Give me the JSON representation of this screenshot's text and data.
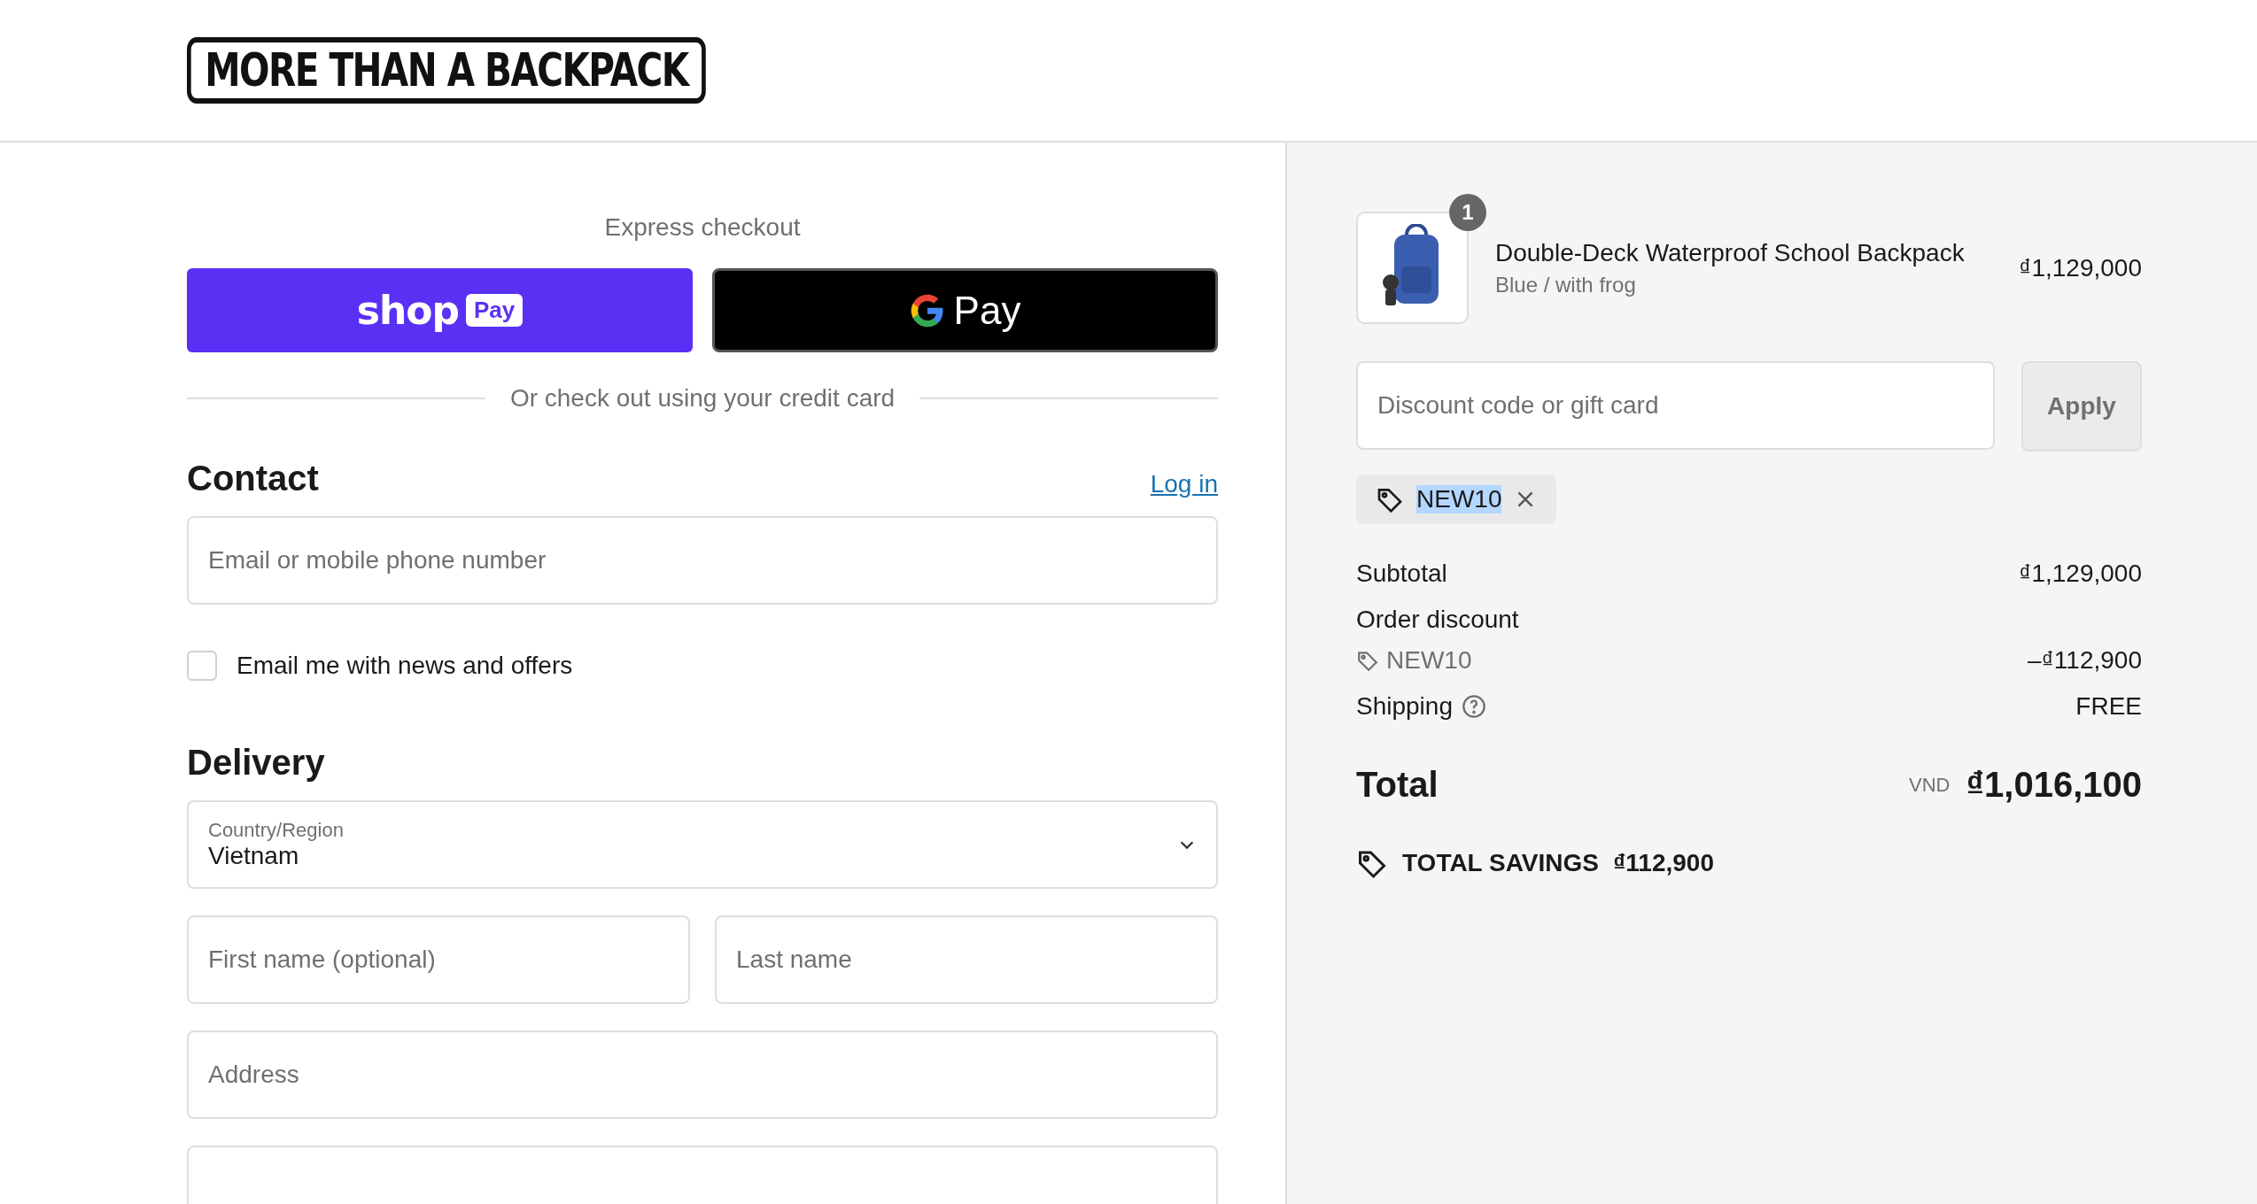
{
  "header": {
    "logo": "MORE THAN A BACKPACK"
  },
  "express_checkout": {
    "title": "Express checkout",
    "shop_pay": {
      "wordmark": "shop",
      "badge": "Pay"
    },
    "google_pay": {
      "label": "Pay"
    },
    "divider": "Or check out using your credit card"
  },
  "contact": {
    "title": "Contact",
    "login_link": "Log in",
    "email": {
      "placeholder": "Email or mobile phone number"
    },
    "newsletter": {
      "label": "Email me with news and offers",
      "checked": false
    }
  },
  "delivery": {
    "title": "Delivery",
    "fields": [
      {
        "kind": "select",
        "label": "Country/Region",
        "value": "Vietnam"
      },
      {
        "kind": "pair",
        "items": [
          {
            "placeholder": "First name (optional)"
          },
          {
            "placeholder": "Last name"
          }
        ]
      },
      {
        "kind": "text",
        "placeholder": "Address"
      },
      {
        "kind": "text"
      }
    ]
  },
  "summary": {
    "item": {
      "quantity": "1",
      "name": "Double-Deck Waterproof School Backpack",
      "variant": "Blue / with frog",
      "price": "₫1,129,000"
    },
    "discount": {
      "placeholder": "Discount code or gift card",
      "button": "Apply",
      "applied_code": {
        "code": "NEW10",
        "selected": true
      }
    },
    "lines": [
      {
        "kind": "plain",
        "label": "Subtotal",
        "value": "₫1,129,000"
      },
      {
        "kind": "discount",
        "label": "Order discount",
        "code": "NEW10",
        "value": "–₫112,900"
      },
      {
        "kind": "help",
        "label": "Shipping",
        "value": "FREE"
      }
    ],
    "total": {
      "label": "Total",
      "currency": "VND",
      "value": "₫1,016,100"
    },
    "savings": {
      "label": "TOTAL SAVINGS",
      "value": "₫112,900"
    }
  }
}
